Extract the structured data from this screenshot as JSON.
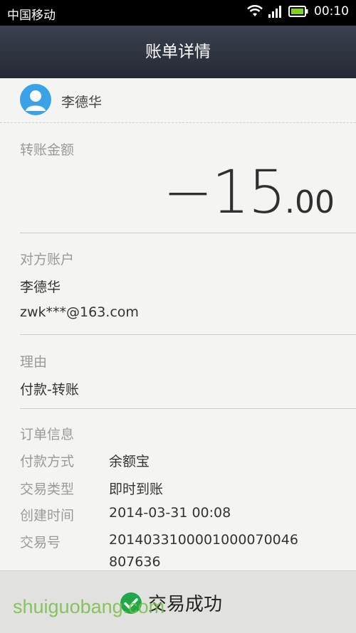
{
  "status_bar": {
    "carrier": "中国移动",
    "time": "00:10"
  },
  "header": {
    "title": "账单详情"
  },
  "user": {
    "name": "李德华"
  },
  "amount": {
    "label": "转账金额",
    "integer": "−15",
    "decimal": ".00"
  },
  "counterparty": {
    "label": "对方账户",
    "name": "李德华",
    "account": "zwk***@163.com"
  },
  "reason": {
    "label": "理由",
    "value": "付款-转账"
  },
  "order": {
    "label": "订单信息",
    "rows": [
      {
        "key": "付款方式",
        "value": "余额宝"
      },
      {
        "key": "交易类型",
        "value": "即时到账"
      },
      {
        "key": "创建时间",
        "value": "2014-03-31 00:08"
      },
      {
        "key": "交易号",
        "value_line1": "201403310000100007004​6",
        "value_line2": "807636"
      }
    ]
  },
  "status": {
    "text": "交易成功",
    "color": "#1ea84a"
  },
  "watermark": {
    "text": "shuiguobang.com"
  }
}
